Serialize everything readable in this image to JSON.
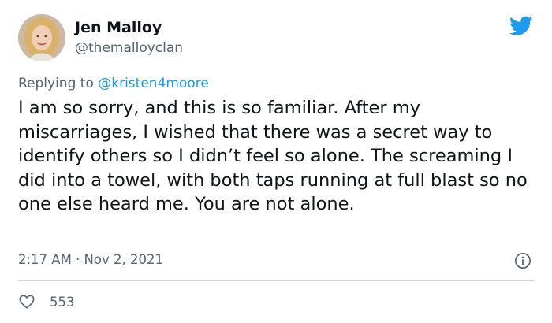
{
  "author": {
    "name": "Jen Malloy",
    "handle": "@themalloyclan",
    "avatar_icon": "user-avatar-photo"
  },
  "brand": {
    "icon": "twitter-bird-icon",
    "color": "#1d9bf0"
  },
  "reply": {
    "prefix": "Replying to",
    "mention": "@kristen4moore"
  },
  "tweet": {
    "text": "I am so sorry, and this is so familiar. After my miscarriages, I wished that there was a secret way to identify others so I didn’t feel so alone. The screaming I did into a towel, with both taps running at full blast so no one else heard me. You are not alone.",
    "timestamp": "2:17 AM · Nov 2, 2021"
  },
  "engagement": {
    "likes": "553",
    "like_icon": "heart-icon",
    "info_icon": "info-icon"
  },
  "colors": {
    "text": "#0f1419",
    "secondary": "#536471",
    "link": "#1d9bf0",
    "divider": "#cfd9de"
  }
}
